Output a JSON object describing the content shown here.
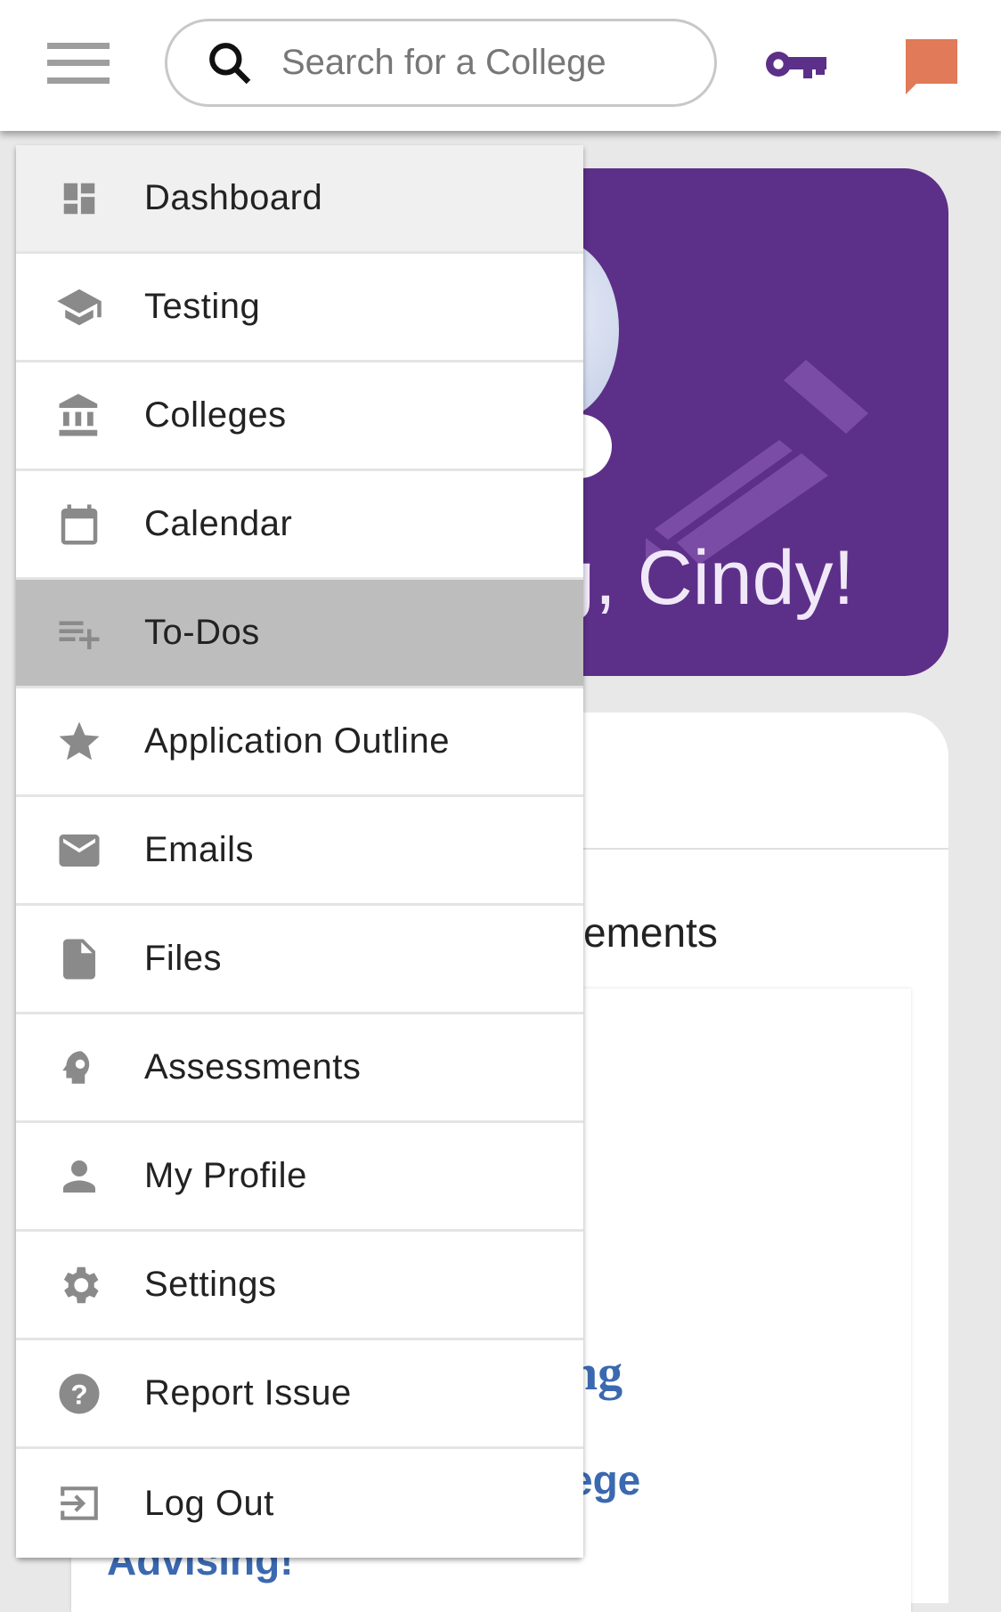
{
  "header": {
    "search_placeholder": "Search for a College",
    "colors": {
      "key": "#5c2f88",
      "chat": "#e07a59"
    }
  },
  "hero": {
    "greeting": "g, Cindy!",
    "color": "#5c2f88"
  },
  "card": {
    "heading_partial": "ements",
    "links": [
      "ng",
      "ege",
      "Advising!"
    ]
  },
  "menu": {
    "items": [
      {
        "label": "Dashboard",
        "icon": "dashboard-icon"
      },
      {
        "label": "Testing",
        "icon": "graduation-cap-icon"
      },
      {
        "label": "Colleges",
        "icon": "institution-icon"
      },
      {
        "label": "Calendar",
        "icon": "calendar-icon"
      },
      {
        "label": "To-Dos",
        "icon": "playlist-add-icon",
        "active": true
      },
      {
        "label": "Application Outline",
        "icon": "star-icon"
      },
      {
        "label": "Emails",
        "icon": "mail-icon"
      },
      {
        "label": "Files",
        "icon": "file-icon"
      },
      {
        "label": "Assessments",
        "icon": "psychology-icon"
      },
      {
        "label": "My Profile",
        "icon": "person-icon"
      },
      {
        "label": "Settings",
        "icon": "gear-icon"
      },
      {
        "label": "Report Issue",
        "icon": "help-icon"
      },
      {
        "label": "Log Out",
        "icon": "logout-icon"
      }
    ]
  }
}
